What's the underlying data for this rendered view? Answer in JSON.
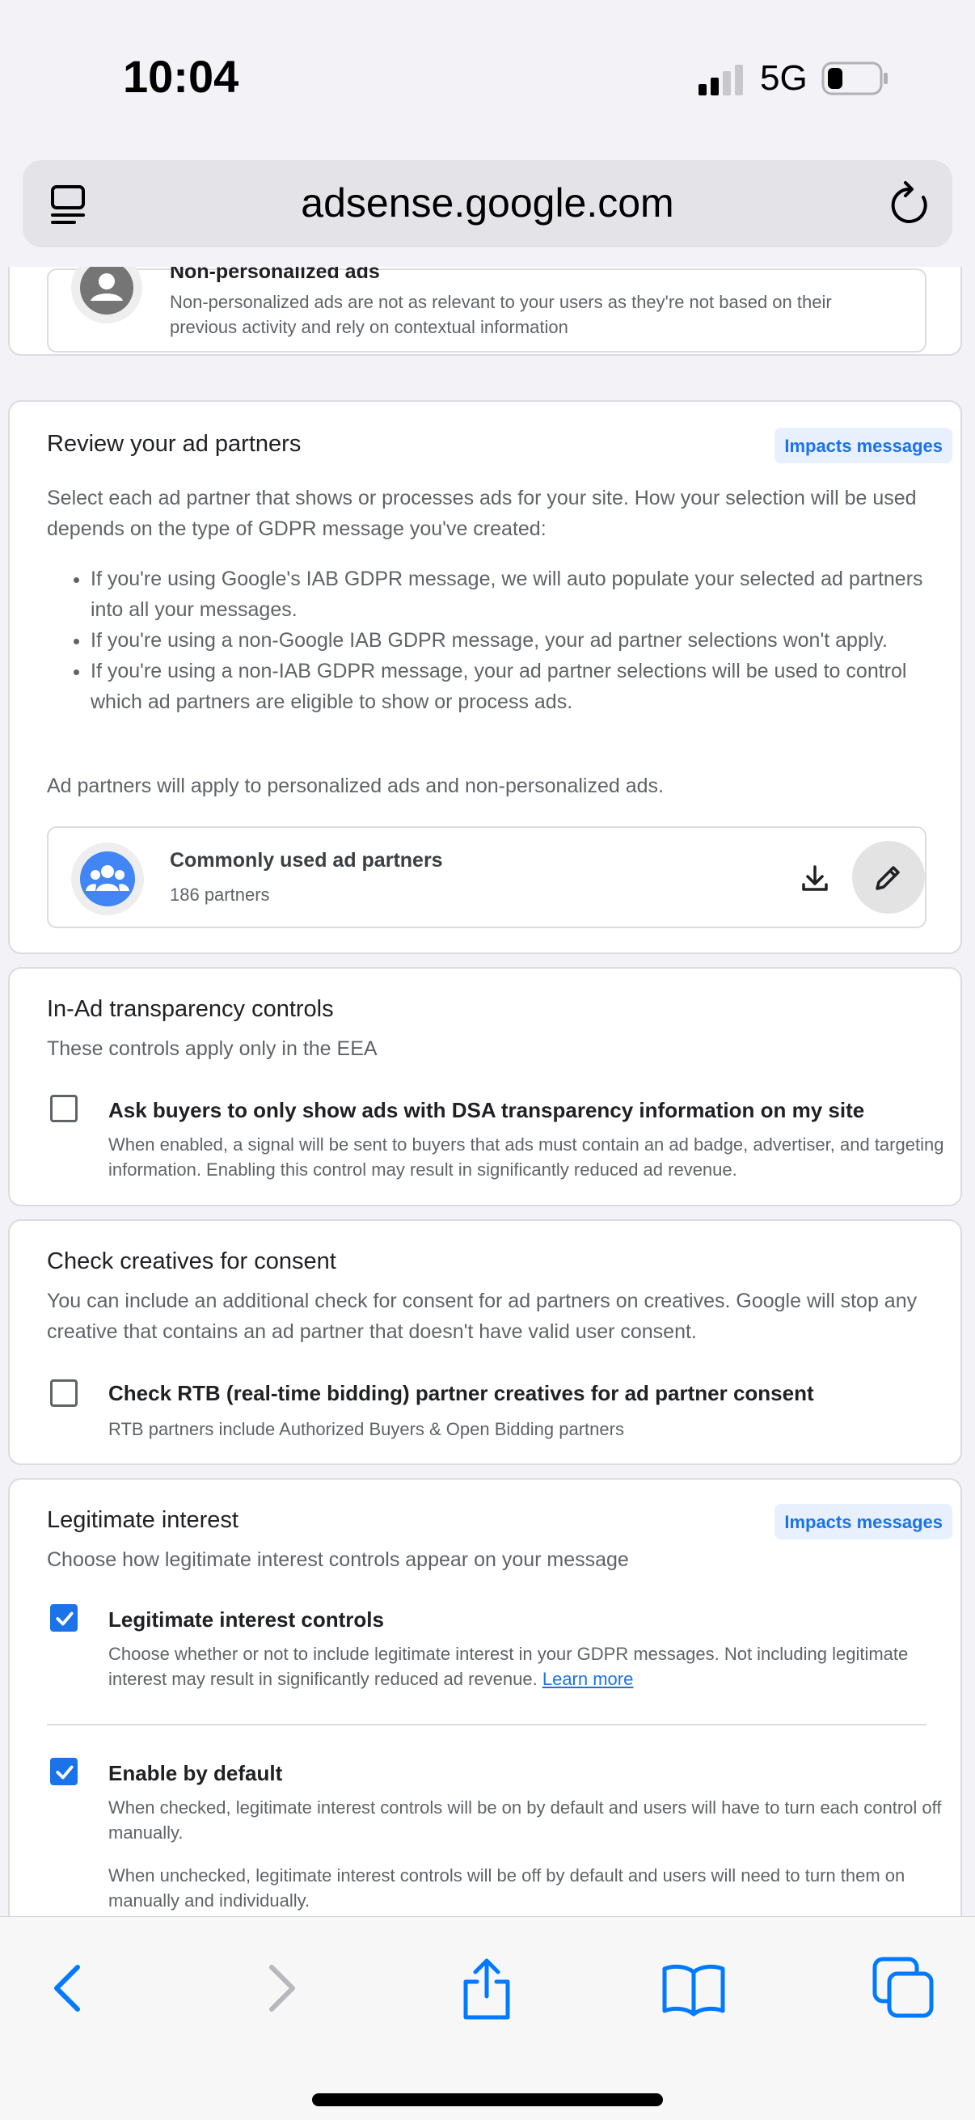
{
  "status_bar": {
    "time": "10:04",
    "network": "5G"
  },
  "browser": {
    "url": "adsense.google.com"
  },
  "non_personalized": {
    "title": "Non-personalized ads",
    "description": "Non-personalized ads are not as relevant to your users as they're not based on their previous activity and rely on contextual information"
  },
  "ad_partners": {
    "title": "Review your ad partners",
    "badge": "Impacts messages",
    "intro": "Select each ad partner that shows or processes ads for your site. How your selection will be used depends on the type of GDPR message you've created:",
    "bullets": [
      "If you're using Google's IAB GDPR message, we will auto populate your selected ad partners into all your messages.",
      "If you're using a non-Google IAB GDPR message, your ad partner selections won't apply.",
      "If you're using a non-IAB GDPR message, your ad partner selections will be used to control which ad partners are eligible to show or process ads."
    ],
    "note": "Ad partners will apply to personalized ads and non-personalized ads.",
    "partner_list": {
      "name": "Commonly used ad partners",
      "count": "186 partners"
    }
  },
  "transparency": {
    "title": "In-Ad transparency controls",
    "subtitle": "These controls apply only in the EEA",
    "option_label": "Ask buyers to only show ads with DSA transparency information on my site",
    "option_desc": "When enabled, a signal will be sent to buyers that ads must contain an ad badge, advertiser, and targeting information. Enabling this control may result in significantly reduced ad revenue.",
    "checked": false
  },
  "consent": {
    "title": "Check creatives for consent",
    "intro": "You can include an additional check for consent for ad partners on creatives. Google will stop any creative that contains an ad partner that doesn't have valid user consent.",
    "option_label": "Check RTB (real-time bidding) partner creatives for ad partner consent",
    "option_desc": "RTB partners include Authorized Buyers & Open Bidding partners",
    "checked": false
  },
  "legitimate_interest": {
    "title": "Legitimate interest",
    "badge": "Impacts messages",
    "subtitle": "Choose how legitimate interest controls appear on your message",
    "controls_label": "Legitimate interest controls",
    "controls_desc": "Choose whether or not to include legitimate interest in your GDPR messages. Not including legitimate interest may result in significantly reduced ad revenue.",
    "learn_more": "Learn more",
    "controls_checked": true,
    "default_label": "Enable by default",
    "default_desc_checked": "When checked, legitimate interest controls will be on by default and users will have to turn each control off manually.",
    "default_desc_unchecked": "When unchecked, legitimate interest controls will be off by default and users will need to turn them on manually and individually.",
    "default_checked": true
  },
  "colors": {
    "accent": "#1a73e8",
    "badge_bg": "#e8f0fe",
    "ios_blue": "#007aff"
  }
}
